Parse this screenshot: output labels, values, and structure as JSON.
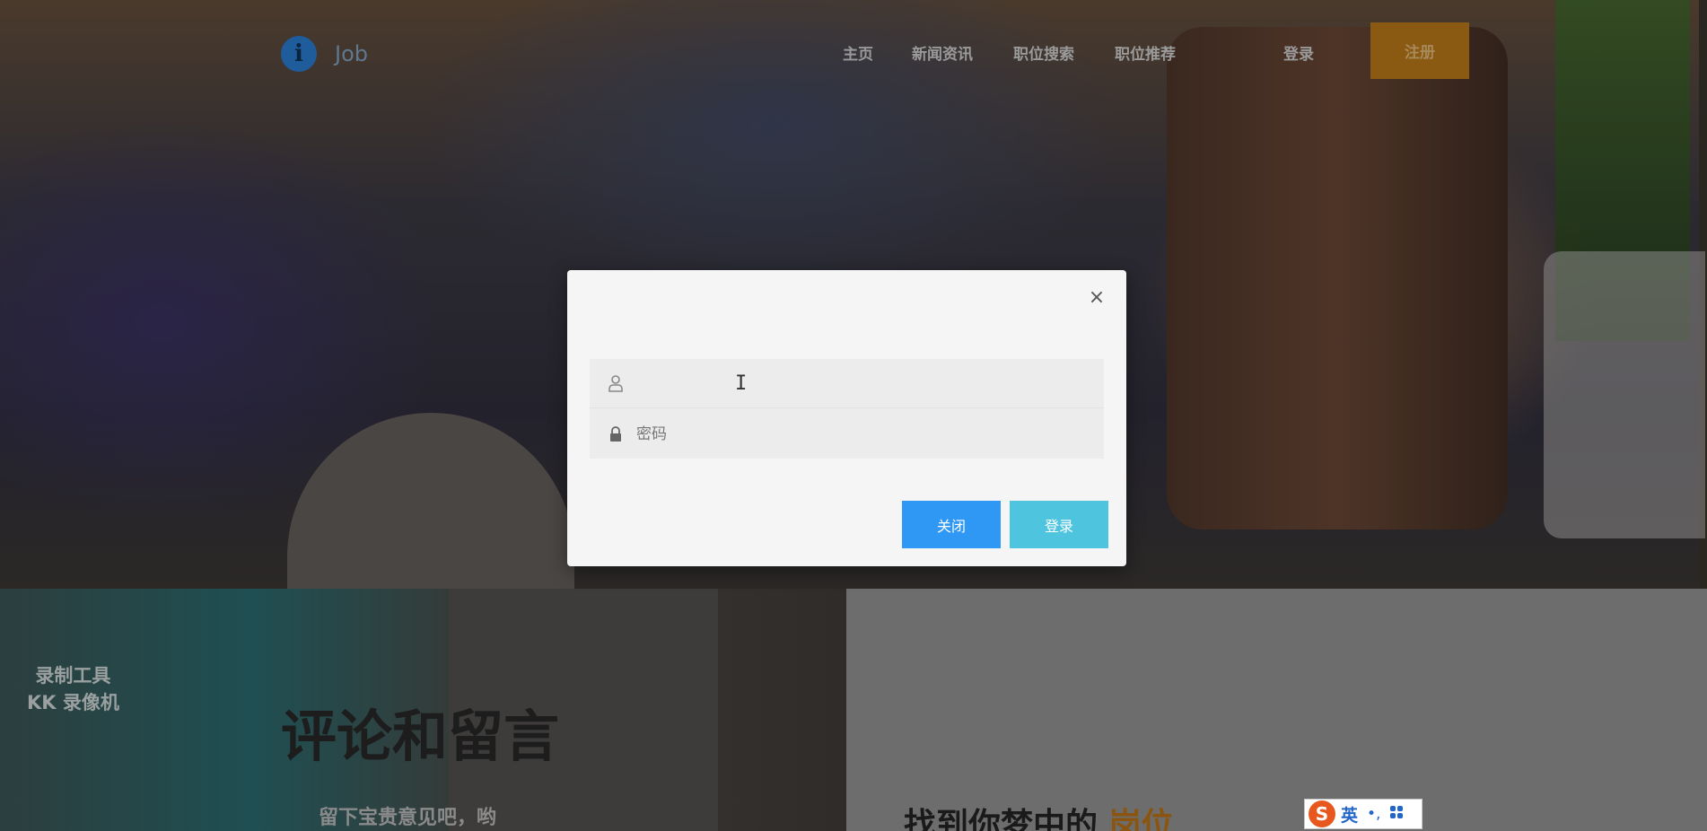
{
  "nav": {
    "logo_text": "Job",
    "items": [
      {
        "label": "主页"
      },
      {
        "label": "新闻资讯"
      },
      {
        "label": "职位搜索"
      },
      {
        "label": "职位推荐"
      }
    ],
    "login_label": "登录",
    "register_label": "注册"
  },
  "modal": {
    "username": {
      "value": "",
      "placeholder": "",
      "icon": "user-icon"
    },
    "password": {
      "value": "",
      "placeholder": "密码",
      "icon": "lock-icon"
    },
    "close_button": "关闭",
    "login_button": "登录"
  },
  "page": {
    "watermark_line1": "录制工具",
    "watermark_line2": "KK 录像机",
    "section_title": "评论和留言",
    "section_subtitle": "留下宝贵意见吧，哟",
    "right_title_prefix": "找到你梦中的",
    "right_title_accent": "岗位"
  },
  "ime": {
    "logo": "S",
    "mode": "英",
    "punct": "•,"
  },
  "colors": {
    "register_button": "#8a5a12",
    "close_button": "#2f98f5",
    "login_button": "#4ec4df",
    "modal_bg": "#f5f5f5"
  }
}
